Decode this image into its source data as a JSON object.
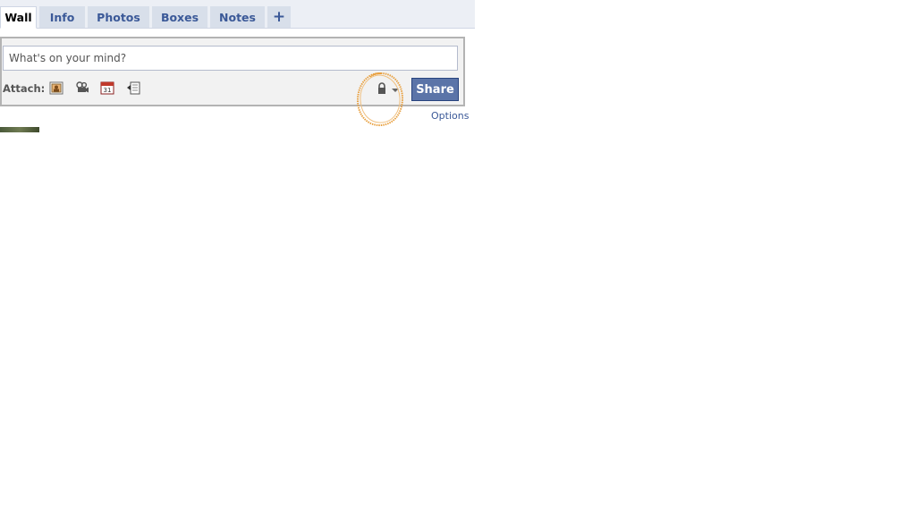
{
  "tabs": [
    {
      "id": "wall",
      "label": "Wall",
      "active": true
    },
    {
      "id": "info",
      "label": "Info",
      "active": false
    },
    {
      "id": "photos",
      "label": "Photos",
      "active": false
    },
    {
      "id": "boxes",
      "label": "Boxes",
      "active": false
    },
    {
      "id": "notes",
      "label": "Notes",
      "active": false
    },
    {
      "id": "add",
      "label": "+",
      "active": false
    }
  ],
  "publisher": {
    "placeholder": "What's on your mind?",
    "attach_label": "Attach:",
    "attach_icons": [
      "photo-icon",
      "video-icon",
      "event-icon",
      "link-icon"
    ],
    "privacy_icons": [
      "lock-icon",
      "dropdown-arrow-icon"
    ],
    "share_label": "Share",
    "options_label": "Options"
  },
  "colors": {
    "brand_blue": "#3b5998",
    "share_button": "#5b74a8",
    "tab_bg": "#d8dfea",
    "annotation": "#e8a040"
  }
}
